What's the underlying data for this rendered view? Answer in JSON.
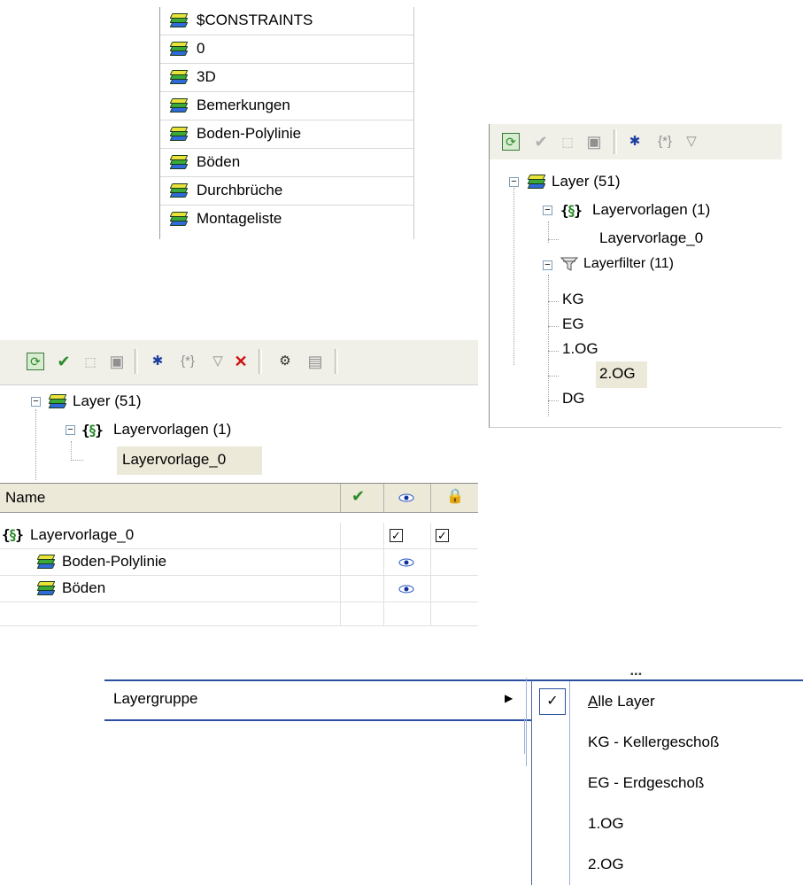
{
  "layer_list": {
    "items": [
      "$CONSTRAINTS",
      "0",
      "3D",
      "Bemerkungen",
      "Boden-Polylinie",
      "Böden",
      "Durchbrüche",
      "Montageliste"
    ]
  },
  "tree_b": {
    "root": "Layer (51)",
    "vorlagen": "Layervorlagen (1)",
    "vorlage0": "Layervorlage_0",
    "filter": "Layerfilter (11)",
    "filter_items": [
      "KG",
      "EG",
      "1.OG",
      "2.OG",
      "DG"
    ]
  },
  "tree_c": {
    "root": "Layer (51)",
    "vorlagen": "Layervorlagen (1)",
    "vorlage0": "Layervorlage_0"
  },
  "table": {
    "col_name": "Name",
    "rows": [
      {
        "name": "Layervorlage_0",
        "visible_checked": true,
        "lock_checked": true
      },
      {
        "name": "Boden-Polylinie"
      },
      {
        "name": "Böden"
      }
    ]
  },
  "menu": {
    "item_prefix": "Layer",
    "item_mnemonic": "g",
    "item_suffix": "ruppe",
    "submenu_first_mnemonic": "A",
    "submenu_first_rest": "lle Layer",
    "submenu": [
      "KG - Kellergeschoß",
      "EG - Erdgeschoß",
      "1.OG",
      "2.OG"
    ]
  },
  "colors": {
    "selection": "#ece9d8",
    "menu_border": "#2b4fa0"
  }
}
